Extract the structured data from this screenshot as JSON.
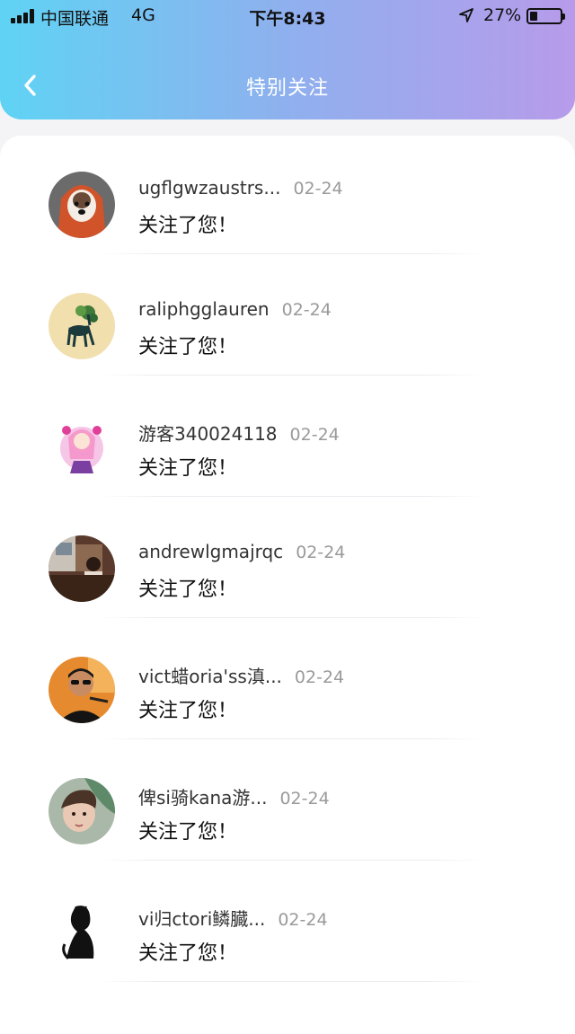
{
  "status_bar": {
    "carrier": "中国联通",
    "network": "4G",
    "time": "下午8:43",
    "battery_percent": "27%",
    "battery_level": 0.27
  },
  "header": {
    "title": "特别关注",
    "back_icon": "chevron-left-icon"
  },
  "colors": {
    "header_gradient_start": "#5fd3f4",
    "header_gradient_end": "#b79bea"
  },
  "notifications": [
    {
      "name": "ugflgwzaustrs...",
      "date": "02-24",
      "message": "关注了您！"
    },
    {
      "name": "raliphgglauren",
      "date": "02-24",
      "message": "关注了您！"
    },
    {
      "name": "游客340024118",
      "date": "02-24",
      "message": "关注了您！"
    },
    {
      "name": "andrewlgmajrqc",
      "date": "02-24",
      "message": "关注了您！"
    },
    {
      "name": "vict蜡oria'ss滇...",
      "date": "02-24",
      "message": "关注了您！"
    },
    {
      "name": "俾si骑kana游...",
      "date": "02-24",
      "message": "关注了您！"
    },
    {
      "name": "vi归ctori鳞臓...",
      "date": "02-24",
      "message": "关注了您！"
    }
  ]
}
